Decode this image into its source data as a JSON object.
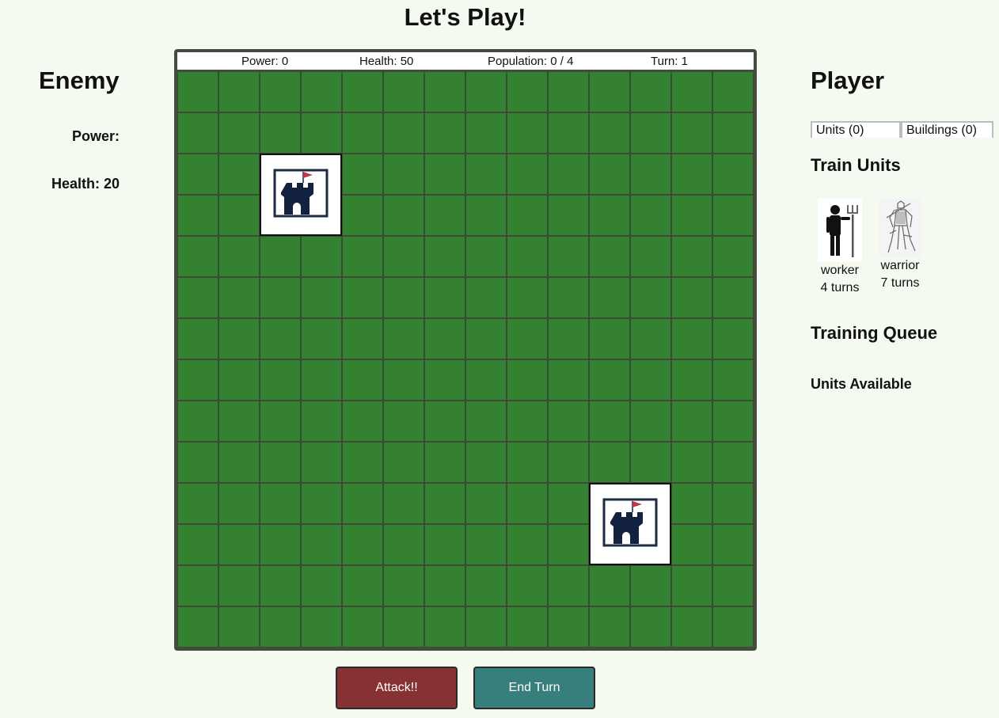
{
  "title": "Let's Play!",
  "enemy": {
    "heading": "Enemy",
    "power_label": "Power:",
    "health_label": "Health: 20"
  },
  "status": {
    "power": "Power: 0",
    "health": "Health: 50",
    "population": "Population: 0 / 4",
    "turn": "Turn: 1"
  },
  "board": {
    "rows": 14,
    "cols": 14,
    "tile_color": "#348231",
    "castles": [
      {
        "owner": "enemy",
        "icon": "castle-icon",
        "row": 3,
        "col": 3,
        "size": 2
      },
      {
        "owner": "player",
        "icon": "castle-icon",
        "row": 11,
        "col": 11,
        "size": 2
      }
    ]
  },
  "buttons": {
    "attack": "Attack!!",
    "end_turn": "End Turn",
    "attack_color": "#873232",
    "end_turn_color": "#377f7d"
  },
  "player": {
    "heading": "Player",
    "tabs": [
      "Units (0)",
      "Buildings (0)"
    ],
    "train_heading": "Train Units",
    "units": [
      {
        "name": "worker",
        "time": "4 turns",
        "icon": "worker-icon"
      },
      {
        "name": "warrior",
        "time": "7 turns",
        "icon": "warrior-icon"
      }
    ],
    "queue_heading": "Training Queue",
    "available_heading": "Units Available"
  }
}
